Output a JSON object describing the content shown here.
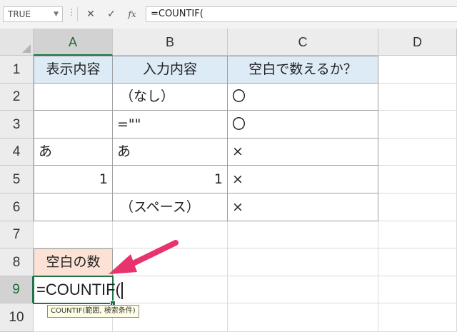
{
  "formula_bar": {
    "name_box": "TRUE",
    "cancel": "✕",
    "enter": "✓",
    "fx": "fx",
    "formula": "=COUNTIF("
  },
  "columns": [
    "A",
    "B",
    "C",
    "D"
  ],
  "rows": [
    "1",
    "2",
    "3",
    "4",
    "5",
    "6",
    "7",
    "8",
    "9",
    "10"
  ],
  "table": {
    "headers": [
      "表示内容",
      "入力内容",
      "空白で数えるか？"
    ],
    "rows": [
      [
        "",
        "（なし）",
        "〇"
      ],
      [
        "",
        "=\"\"",
        "〇"
      ],
      [
        "あ",
        "あ",
        "×"
      ],
      [
        "1",
        "1",
        "×"
      ],
      [
        "",
        "（スペース）",
        "×"
      ]
    ]
  },
  "a8_label": "空白の数",
  "active_cell": {
    "address": "A9",
    "content": "=COUNTIF("
  },
  "tooltip": "COUNTIF(範囲, 検索条件)",
  "colors": {
    "accent_green": "#217346",
    "header_fill": "#ddebf7",
    "label_fill": "#fbe2d5",
    "arrow": "#e8336d"
  }
}
